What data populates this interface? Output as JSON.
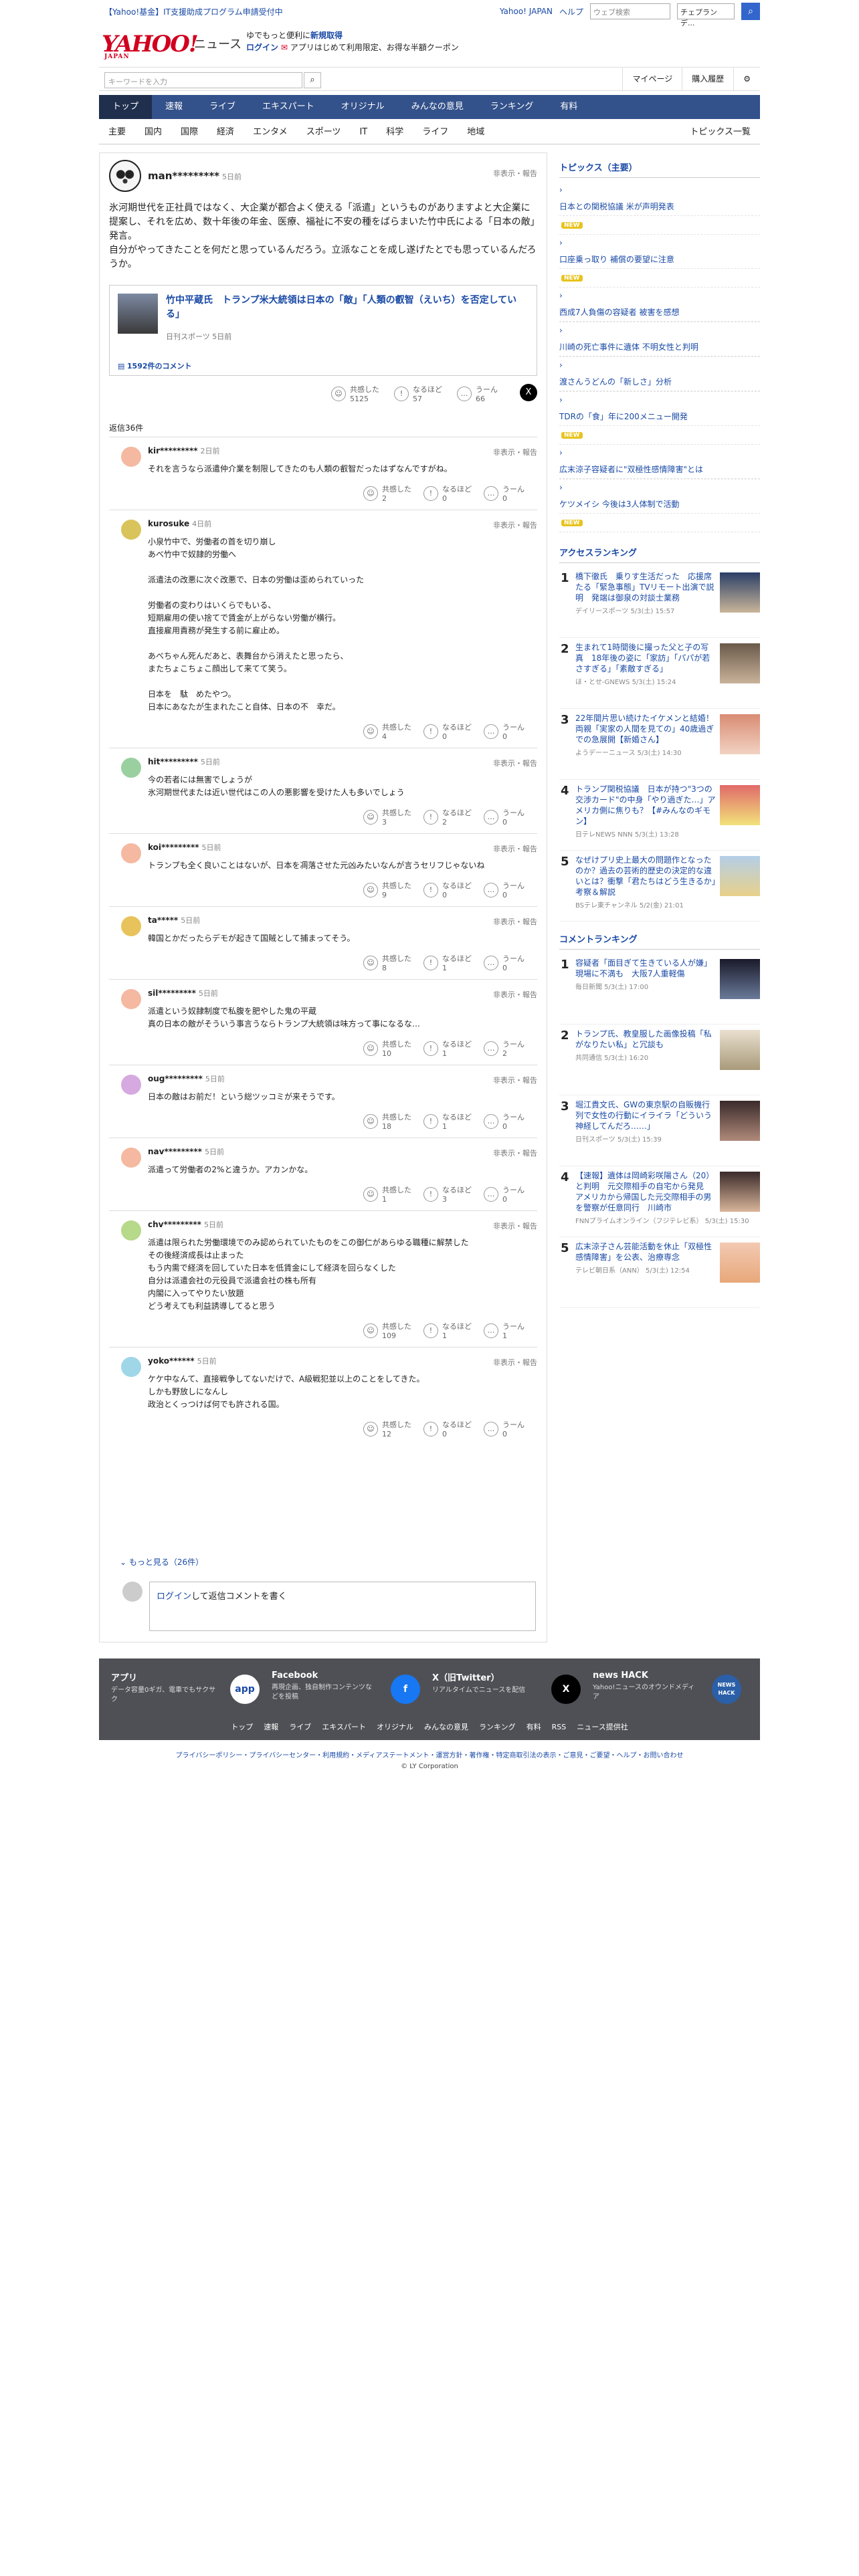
{
  "topbar": {
    "notice": "【Yahoo!基金】IT支援助成プログラム申請受付中",
    "links": [
      "Yahoo! JAPAN",
      "ヘルプ"
    ],
    "search_placeholder": "ウェブ検索",
    "search_value": "チェプランデ...",
    "search_button": "検索"
  },
  "header": {
    "logo": "YAHOO!",
    "logo_sub": "JAPAN",
    "service": "ニュース",
    "promo1": "ゆでもっと便利に",
    "promo_new": "新規取得",
    "login": "ログイン",
    "promo2": "アプリはじめて利用限定、お得な半額クーポン"
  },
  "searchbar": {
    "placeholder": "キーワードを入力",
    "mypage": "マイページ",
    "history": "購入履歴"
  },
  "nav": [
    "トップ",
    "速報",
    "ライブ",
    "エキスパート",
    "オリジナル",
    "みんなの意見",
    "ランキング",
    "有料"
  ],
  "subnav": [
    "主要",
    "国内",
    "国際",
    "経済",
    "エンタメ",
    "スポーツ",
    "IT",
    "科学",
    "ライフ",
    "地域"
  ],
  "subnav_right": "トピックス一覧",
  "article": {
    "user": "man*********",
    "time": "5日前",
    "report": "非表示・報告",
    "body": "氷河期世代を正社員ではなく、大企業が都合よく使える「派遣」というものがありますよと大企業に提案し、それを広め、数十年後の年金、医療、福祉に不安の種をばらまいた竹中氏による「日本の敵」発言。\n自分がやってきたことを何だと思っているんだろう。立派なことを成し遂げたとでも思っているんだろうか。",
    "card_title": "竹中平蔵氏　トランプ米大統領は日本の「敵」「人類の叡智（えいち）を否定している」",
    "card_source": "日刊スポーツ 5日前",
    "card_comments": "1592件のコメント",
    "agree": "5125",
    "naruhodo": "57",
    "uun": "66",
    "label_agree": "共感した",
    "label_naruhodo": "なるほど",
    "label_uun": "うーん"
  },
  "reply_count": "返信36件",
  "comments": [
    {
      "user": "kir*********",
      "time": "2日前",
      "text": "それを言うなら派遣仲介業を制限してきたのも人類の叡智だったはずなんですがね。",
      "agree": "2",
      "naruhodo": "0",
      "uun": "0"
    },
    {
      "user": "kurosuke",
      "time": "4日前",
      "text": "小泉竹中で、労働者の首を切り崩し\nあべ竹中で奴隷的労働へ\n\n派遣法の改悪に次ぐ改悪で、日本の労働は歪められていった\n\n労働者の変わりはいくらでもいる、\n短期雇用の使い捨てで賃金が上がらない労働が横行。\n直接雇用責務が発生する前に雇止め。\n\nあべちゃん死んだあと、表舞台から消えたと思ったら、\nまたちょこちょこ顔出して来てて笑う。\n\n日本を　駄　めたやつ。\n日本にあなたが生まれたこと自体、日本の不　幸だ。",
      "agree": "4",
      "naruhodo": "0",
      "uun": "0"
    },
    {
      "user": "hit*********",
      "time": "5日前",
      "text": "今の若者には無害でしょうが\n氷河期世代または近い世代はこの人の悪影響を受けた人も多いでしょう",
      "agree": "3",
      "naruhodo": "2",
      "uun": "0"
    },
    {
      "user": "koi*********",
      "time": "5日前",
      "text": "トランプも全く良いことはないが、日本を凋落させた元凶みたいなんが言うセリフじゃないね",
      "agree": "9",
      "naruhodo": "0",
      "uun": "0"
    },
    {
      "user": "ta*****",
      "time": "5日前",
      "text": "韓国とかだったらデモが起きて国賊として捕まってそう。",
      "agree": "8",
      "naruhodo": "1",
      "uun": "0"
    },
    {
      "user": "sil*********",
      "time": "5日前",
      "text": "派遣という奴隷制度で私腹を肥やした鬼の平蔵\n真の日本の敵がそういう事言うならトランプ大統領は味方って事になるな…",
      "agree": "10",
      "naruhodo": "1",
      "uun": "2"
    },
    {
      "user": "oug*********",
      "time": "5日前",
      "text": "日本の敵はお前だ！という総ツッコミが来そうです。",
      "agree": "18",
      "naruhodo": "1",
      "uun": "0"
    },
    {
      "user": "nav*********",
      "time": "5日前",
      "text": "派遣って労働者の2%と違うか。アカンかな。",
      "agree": "1",
      "naruhodo": "3",
      "uun": "0"
    },
    {
      "user": "chv*********",
      "time": "5日前",
      "text": "派遣は限られた労働環境でのみ認められていたものをこの御仁があらゆる職種に解禁した\nその後経済成長は止まった\nもう内需で経済を回していた日本を低賃金にして経済を回らなくした\n自分は派遣会社の元役員で派遣会社の株も所有\n内閣に入ってやりたい放題\nどう考えても利益誘導してると思う",
      "agree": "109",
      "naruhodo": "1",
      "uun": "1"
    },
    {
      "user": "yoko******",
      "time": "5日前",
      "text": "ケケ中なんて、直接戦争してないだけで、A級戦犯並以上のことをしてきた。\nしかも野放しになんし\n政治とくっつけば何でも許される国。",
      "agree": "12",
      "naruhodo": "0",
      "uun": "0"
    }
  ],
  "more_replies": "もっと見る（26件）",
  "reply_box": {
    "login": "ログイン",
    "text": "して返信コメントを書く"
  },
  "sidebar": {
    "topics_title": "トピックス（主要）",
    "topics": [
      {
        "t": "日本との関税協議 米が声明発表",
        "badge": "NEW"
      },
      {
        "t": "口座乗っ取り 補償の要望に注意",
        "badge": "NEW"
      },
      {
        "t": "西成7人負傷の容疑者 被害を感想",
        "badge": ""
      },
      {
        "t": "川崎の死亡事件に遺体 不明女性と判明",
        "badge": ""
      },
      {
        "t": "渡さんうどんの「新しさ」分析",
        "badge": ""
      },
      {
        "t": "TDRの「食」年に200メニュー開発",
        "badge": "NEW"
      },
      {
        "t": "広末涼子容疑者に\"双極性感情障害\"とは",
        "badge": ""
      },
      {
        "t": "ケツメイシ 今後は3人体制で活動",
        "badge": "NEW"
      }
    ],
    "access_title": "アクセスランキング",
    "access": [
      {
        "t": "橋下徹氏　乗りす生活だった　応援席たる「緊急事態」TVリモート出演で説明　発端は御泉の対談士業務",
        "s": "デイリースポーツ 5/3(土) 15:57"
      },
      {
        "t": "生まれて1時間後に撮った父と子の写真　18年後の姿に「家訪」「パパが若さすぎる」「素敵すぎる」",
        "s": "ほ・とせ-GNEWS 5/3(土) 15:24"
      },
      {
        "t": "22年間片思い続けたイケメンと結婚！両親「実家の人間を見ての」40歳過ぎでの急展開【新婚さん】",
        "s": "ようデーーニュース 5/3(土) 14:30"
      },
      {
        "t": "トランプ関税協議　日本が持つ\"3つの交渉カード\"の中身「やり過ぎた…」アメリカ側に焦りも？【#みんなのギモン】",
        "s": "日テレNEWS NNN 5/3(土) 13:28"
      },
      {
        "t": "なぜけプリ史上最大の問題作となったのか？過去の芸術的歴史の決定的な違いとは？衝撃「君たちはどう生きるか」考察＆解説",
        "s": "BSテレ東チャンネル 5/2(金) 21:01"
      }
    ],
    "comment_title": "コメントランキング",
    "comment_rank": [
      {
        "t": "容疑者「面目ぎて生きている人が嫌」　現場に不満も　大阪7人重軽傷",
        "s": "毎日新聞 5/3(土) 17:00"
      },
      {
        "t": "トランプ氏、教皇服した画像投稿「私がなりたい私」と冗談も",
        "s": "共同通信 5/3(土) 16:20"
      },
      {
        "t": "堀江貴文氏、GWの東京駅の自販機行列で女性の行動にイライラ「どういう神経してんだろ……」",
        "s": "日刊スポーツ 5/3(土) 15:39"
      },
      {
        "t": "【速報】遺体は岡崎彩咲陽さん（20）と判明　元交際相手の自宅から発見　アメリカから帰国した元交際相手の男を警察が任意同行　川崎市",
        "s": "FNNプライムオンライン（フジテレビ系） 5/3(土) 15:30"
      },
      {
        "t": "広末涼子さん芸能活動を休止「双極性感情障害」を公表、治療専念",
        "s": "テレビ朝日系（ANN） 5/3(土) 12:54"
      }
    ]
  },
  "footer": {
    "blocks": [
      {
        "title": "アプリ",
        "desc": "データ容量0ギガ、電車でもサクサク",
        "icon": "app"
      },
      {
        "title": "Facebook",
        "desc": "再現企画、独自制作コンテンツなどを投稿",
        "icon": "f"
      },
      {
        "title": "X（旧Twitter）",
        "desc": "リアルタイムでニュースを配信",
        "icon": "X"
      },
      {
        "title": "news HACK",
        "desc": "Yahoo!ニュースのオウンドメディア",
        "icon": "NEWS HACK"
      }
    ],
    "links": [
      "トップ",
      "速報",
      "ライブ",
      "エキスパート",
      "オリジナル",
      "みんなの意見",
      "ランキング",
      "有料",
      "RSS",
      "ニュース提供社"
    ],
    "legal": "プライバシーポリシー・プライバシーセンター・利用規約・メディアステートメント・運営方針・著作権・特定商取引法の表示・ご意見・ご要望・ヘルプ・お問い合わせ",
    "copyright": "© LY Corporation"
  },
  "colors": {
    "nav": "#33518a",
    "link": "#1a4aa6",
    "brand": "#d1001f"
  }
}
